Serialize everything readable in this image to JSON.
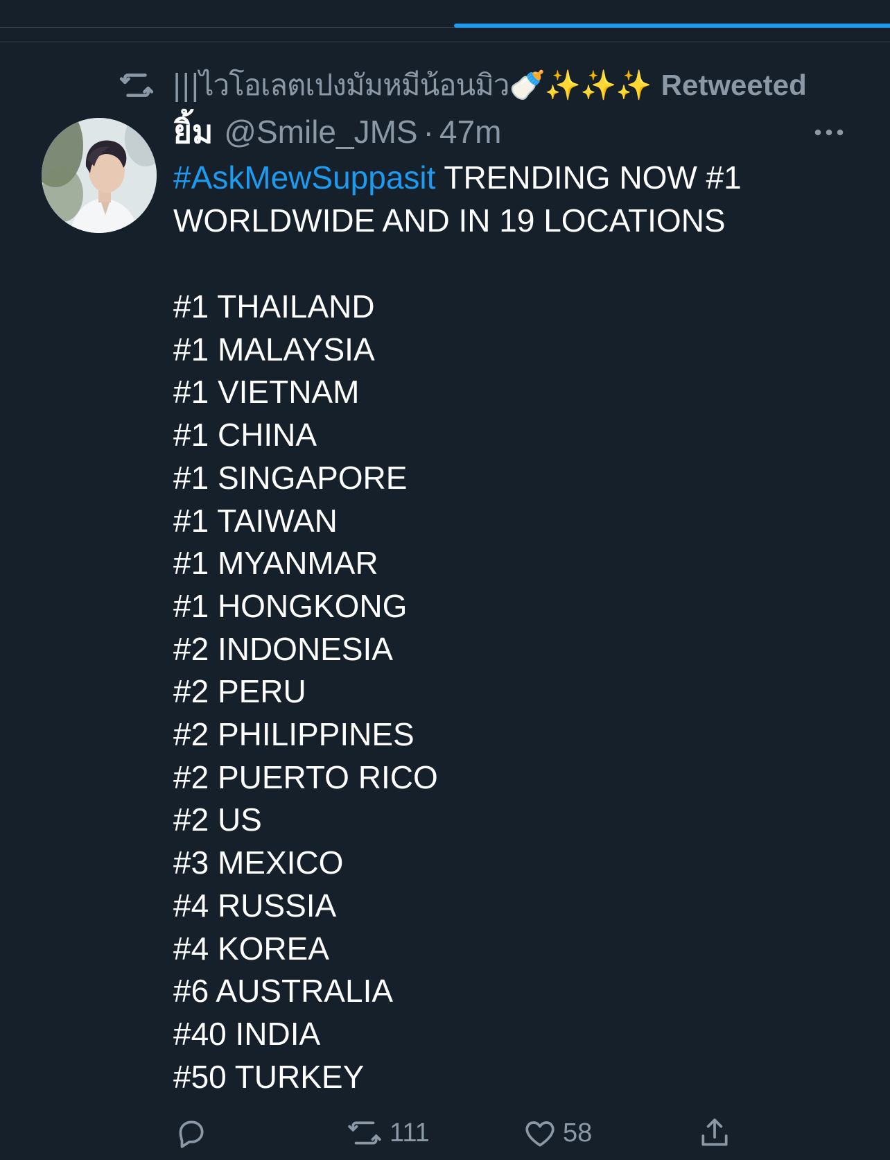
{
  "tabs": {
    "active_index": 1
  },
  "retweet": {
    "icon": "retweet-icon",
    "retweeter_name": "|||ไวโอเลตเปงมัมหมีน้อนมิว🍼✨✨✨",
    "label": "Retweeted"
  },
  "tweet": {
    "avatar": "user-avatar",
    "display_name": "ยิ้ม",
    "handle": "@Smile_JMS",
    "separator": "·",
    "time": "47m",
    "more_icon": "more-options-icon",
    "hashtag": "#AskMewSuppasit",
    "text_after_hashtag": " TRENDING NOW #1 WORLDWIDE AND IN 19 LOCATIONS",
    "rankings": [
      "#1 THAILAND",
      "#1 MALAYSIA",
      "#1 VIETNAM",
      "#1 CHINA",
      "#1 SINGAPORE",
      "#1 TAIWAN",
      "#1 MYANMAR",
      "#1 HONGKONG",
      "#2 INDONESIA",
      "#2 PERU",
      "#2 PHILIPPINES",
      "#2 PUERTO RICO",
      "#2 US",
      "#3 MEXICO",
      "#4 RUSSIA",
      "#4 KOREA",
      "#6 AUSTRALIA",
      "#40 INDIA",
      "#50 TURKEY"
    ]
  },
  "actions": {
    "reply_icon": "reply-icon",
    "retweet_icon": "retweet-icon",
    "retweet_count": "111",
    "like_icon": "heart-icon",
    "like_count": "58",
    "share_icon": "share-icon"
  },
  "colors": {
    "background": "#15202b",
    "accent": "#1d9bf0",
    "muted_text": "#8b98a5",
    "divider": "#38444d"
  }
}
